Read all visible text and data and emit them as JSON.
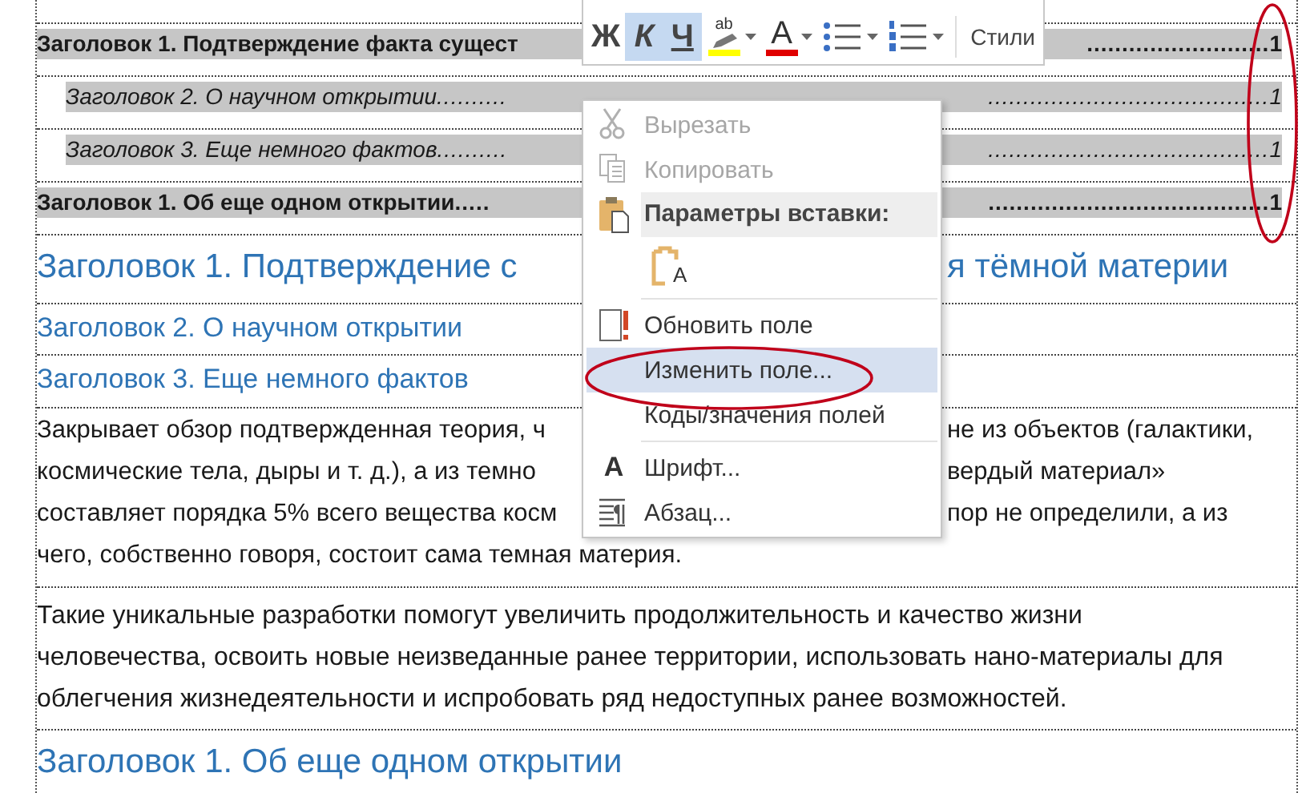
{
  "toc": [
    {
      "kind": "heading1",
      "text": "Заголовок 1. Подтверждение факта сущест",
      "tail_leader": "..........................",
      "page": "1"
    },
    {
      "kind": "heading2",
      "text": "Заголовок 2. О научном открытии",
      "leader": "..........",
      "tail_leader": "........................................",
      "page": "1"
    },
    {
      "kind": "heading3",
      "text": "Заголовок 3. Еще немного фактов",
      "leader": "..........",
      "tail_leader": "........................................",
      "page": "1"
    },
    {
      "kind": "heading1",
      "text": "Заголовок 1. Об еще одном открытии",
      "leader": ".....",
      "tail_leader": "........................................",
      "page": "1"
    }
  ],
  "blocks": [
    {
      "kind": "heading1",
      "left": "Заголовок 1. Подтверждение с",
      "right": "я тёмной материи"
    },
    {
      "kind": "heading2",
      "text": "Заголовок 2. О научном открытии"
    },
    {
      "kind": "heading3",
      "text": "Заголовок 3. Еще немного фактов"
    },
    {
      "kind": "paragraph",
      "lines": [
        {
          "left": "Закрывает обзор подтвержденная теория, ч",
          "right": "не из объектов (галактики,"
        },
        {
          "left": "космические тела, дыры и т. д.), а из темно",
          "right": "вердый материал»"
        },
        {
          "left": "составляет порядка 5% всего вещества косм",
          "right": "пор не определили, а из"
        },
        {
          "text": "чего, собственно говоря, состоит сама темная материя."
        }
      ]
    },
    {
      "kind": "paragraph",
      "lines": [
        {
          "text": "Такие уникальные разработки помогут увеличить продолжительность и качество жизни"
        },
        {
          "text": "человечества, освоить новые неизведанные ранее территории, использовать нано-материалы для"
        },
        {
          "text": "облегчения жизнедеятельности и испробовать ряд недоступных ранее возможностей."
        }
      ]
    },
    {
      "kind": "heading1",
      "text": "Заголовок 1. Об еще одном открытии"
    }
  ],
  "toolbar": {
    "buttons": [
      {
        "kind": "letter",
        "label": "Ж",
        "selected": false
      },
      {
        "kind": "letter",
        "label": "К",
        "selected": true
      },
      {
        "kind": "letter",
        "label": "Ч",
        "selected": true
      },
      {
        "kind": "highlight",
        "glyph": "ab",
        "selected": false
      },
      {
        "kind": "font-color",
        "glyph": "A",
        "selected": false
      },
      {
        "kind": "bullets",
        "selected": false
      },
      {
        "kind": "numbering",
        "selected": false
      },
      {
        "kind": "label",
        "label": "Стили",
        "selected": false
      }
    ]
  },
  "menu": {
    "sections": [
      {
        "items": [
          {
            "kind": "command",
            "label": "Вырезать",
            "disabled": true,
            "selected": false
          },
          {
            "kind": "command",
            "label": "Копировать",
            "disabled": true,
            "selected": false
          },
          {
            "kind": "header",
            "label": "Параметры вставки:"
          },
          {
            "kind": "paste-option",
            "glyph": "A",
            "selected": false
          }
        ]
      },
      {
        "items": [
          {
            "kind": "command",
            "label": "Обновить поле",
            "disabled": false,
            "selected": false
          },
          {
            "kind": "command",
            "label": "Изменить поле...",
            "disabled": false,
            "selected": true
          },
          {
            "kind": "command",
            "label": "Коды/значения полей",
            "disabled": false,
            "selected": false
          }
        ]
      },
      {
        "items": [
          {
            "kind": "command",
            "label": "Шрифт...",
            "glyph": "A",
            "disabled": false,
            "selected": false
          },
          {
            "kind": "command",
            "label": "Абзац...",
            "disabled": false,
            "selected": false
          }
        ]
      }
    ]
  },
  "annotations": [
    {
      "kind": "ellipse"
    },
    {
      "kind": "ellipse"
    }
  ]
}
